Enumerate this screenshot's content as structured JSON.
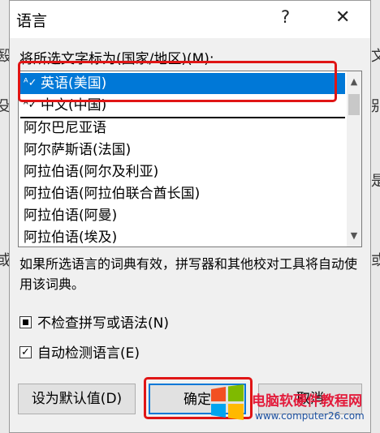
{
  "dialog": {
    "title": "语言",
    "help_icon": "?",
    "close_icon": "✕"
  },
  "list_label": "将所选文字标为(国家/地区)(M):",
  "languages": [
    {
      "label": "英语(美国)",
      "spell": true,
      "selected": true
    },
    {
      "label": "中文(中国)",
      "spell": true,
      "selected": false
    },
    {
      "label": "阿尔巴尼亚语",
      "spell": false,
      "selected": false
    },
    {
      "label": "阿尔萨斯语(法国)",
      "spell": false,
      "selected": false
    },
    {
      "label": "阿拉伯语(阿尔及利亚)",
      "spell": false,
      "selected": false
    },
    {
      "label": "阿拉伯语(阿拉伯联合酋长国)",
      "spell": false,
      "selected": false
    },
    {
      "label": "阿拉伯语(阿曼)",
      "spell": false,
      "selected": false
    },
    {
      "label": "阿拉伯语(埃及)",
      "spell": false,
      "selected": false
    }
  ],
  "description": "如果所选语言的词典有效，拼写器和其他校对工具将自动使用该词典。",
  "options": {
    "no_proofing": {
      "label": "不检查拼写或语法(N)",
      "state": "mixed"
    },
    "detect_language": {
      "label": "自动检测语言(E)",
      "state": "checked"
    }
  },
  "buttons": {
    "set_default": "设为默认值(D)",
    "ok": "确定",
    "cancel": "取消"
  },
  "background_chars": [
    "殹",
    "殳",
    "是",
    "或",
    "文",
    "别"
  ],
  "watermark": {
    "title": "电脑软硬件教程网",
    "url": "www.computer26.com"
  },
  "colors": {
    "selection": "#0078d7",
    "highlight_box": "#e01515"
  }
}
